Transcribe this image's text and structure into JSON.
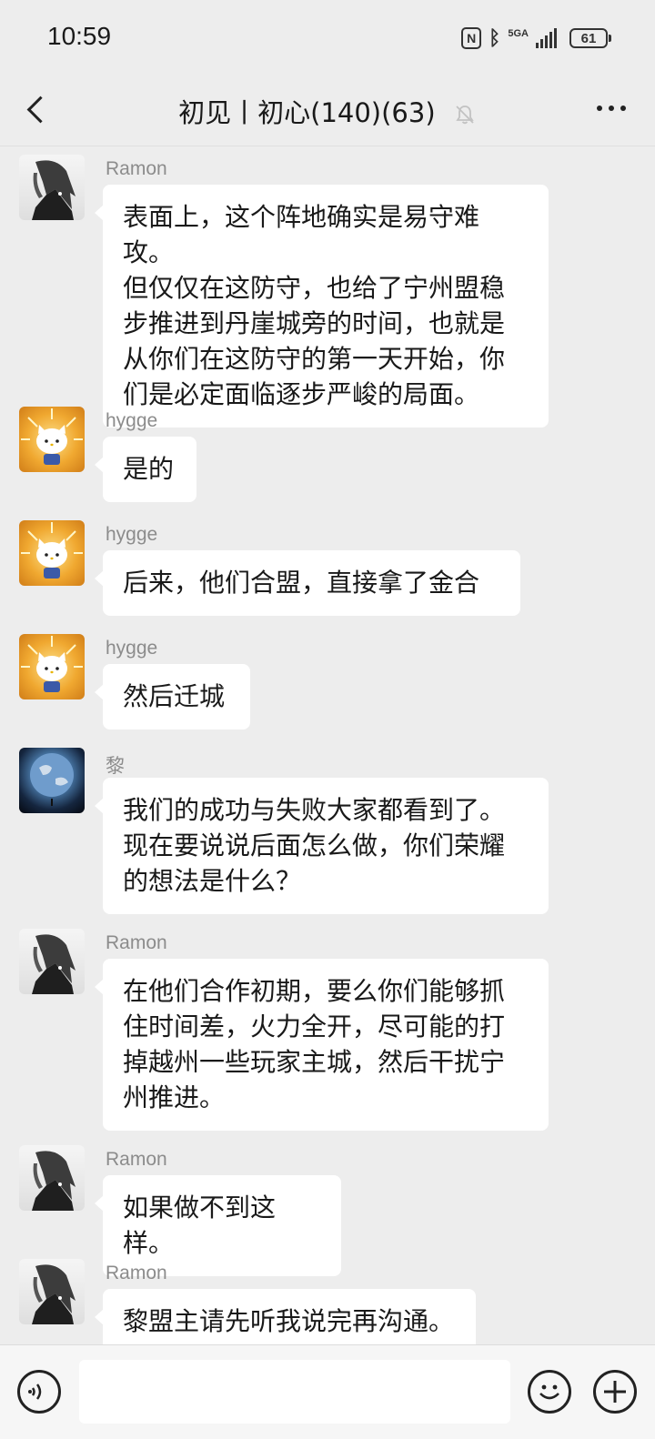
{
  "status_bar": {
    "time": "10:59",
    "network": "5GA",
    "battery": "61"
  },
  "nav": {
    "title": "初见丨初心(140)(63)"
  },
  "messages": [
    {
      "sender": "Ramon",
      "avatar": "ramon-avatar",
      "lines": [
        "表面上，这个阵地确实是易守难攻。",
        "但仅仅在这防守，也给了宁州盟稳",
        "步推进到丹崖城旁的时间，也就是",
        "从你们在这防守的第一天开始，你",
        "们是必定面临逐步严峻的局面。"
      ]
    },
    {
      "sender": "hygge",
      "avatar": "hygge-avatar",
      "lines": [
        "是的"
      ]
    },
    {
      "sender": "hygge",
      "avatar": "hygge-avatar",
      "lines": [
        "后来，他们合盟，直接拿了金合"
      ]
    },
    {
      "sender": "hygge",
      "avatar": "hygge-avatar",
      "lines": [
        "然后迁城"
      ]
    },
    {
      "sender": "黎",
      "avatar": "earth-avatar",
      "lines": [
        "我们的成功与失败大家都看到了。",
        "现在要说说后面怎么做，你们荣耀",
        "的想法是什么？"
      ]
    },
    {
      "sender": "Ramon",
      "avatar": "ramon-avatar",
      "lines": [
        "在他们合作初期，要么你们能够抓",
        "住时间差，火力全开，尽可能的打",
        "掉越州一些玩家主城，然后干扰宁",
        "州推进。"
      ]
    },
    {
      "sender": "Ramon",
      "avatar": "ramon-avatar",
      "lines": [
        "如果做不到这样。"
      ]
    },
    {
      "sender": "Ramon",
      "avatar": "ramon-avatar",
      "lines": [
        "黎盟主请先听我说完再沟通。"
      ]
    }
  ],
  "input": {
    "value": ""
  }
}
